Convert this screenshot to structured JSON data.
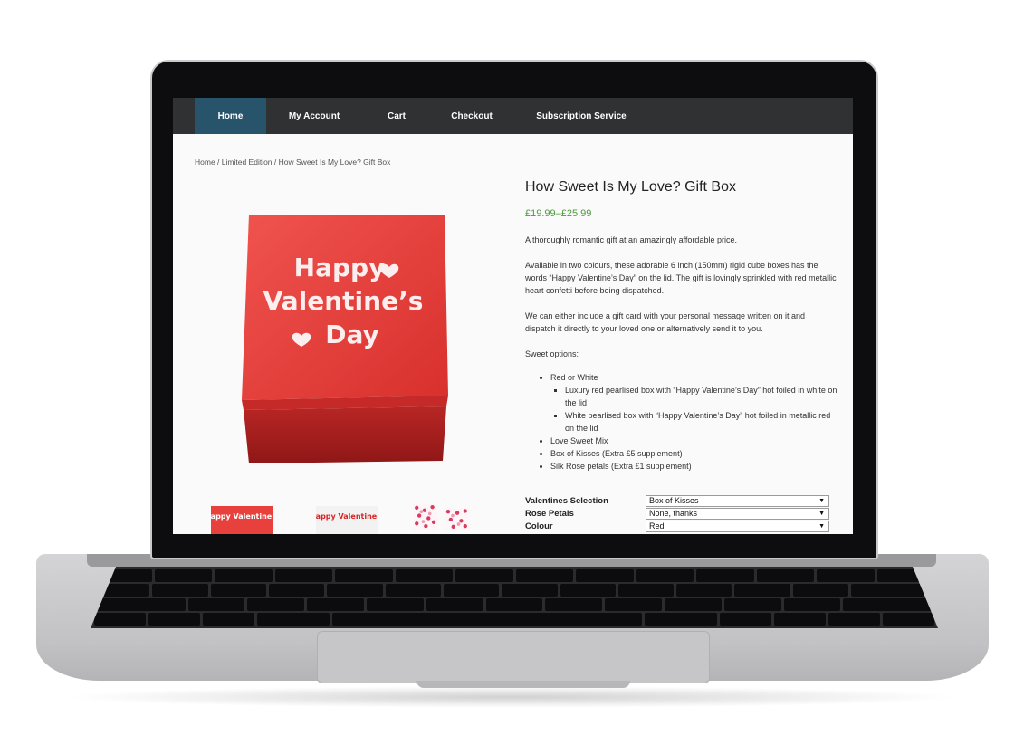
{
  "nav": {
    "items": [
      {
        "label": "Home",
        "active": true
      },
      {
        "label": "My Account"
      },
      {
        "label": "Cart"
      },
      {
        "label": "Checkout"
      },
      {
        "label": "Subscription Service"
      }
    ]
  },
  "breadcrumb": {
    "home": "Home",
    "sep1": " / ",
    "category": "Limited Edition",
    "sep2": " / ",
    "current": "How Sweet Is My Love? Gift Box"
  },
  "product": {
    "title": "How Sweet Is My Love? Gift Box",
    "price": "£19.99–£25.99",
    "box_text": [
      "Happy",
      "Valentine’s",
      "Day"
    ],
    "description": [
      "A thoroughly romantic gift at an amazingly affordable price.",
      "Available in two colours, these adorable 6 inch (150mm) rigid cube boxes has the words “Happy Valentine’s Day” on the lid. The gift is lovingly sprinkled with red metallic heart confetti before being dispatched.",
      "We can either include a gift card with your personal message written on it and dispatch it directly to your loved one or alternatively send it to you.",
      "Sweet options:"
    ],
    "options": {
      "red_or_white": "Red or White",
      "sub": [
        "Luxury red pearlised box with “Happy Valentine’s Day” hot foiled in white on the lid",
        "White pearlised box with “Happy Valentine’s Day” hot foiled in metallic red on the lid"
      ],
      "others": [
        "Love Sweet Mix",
        "Box of Kisses (Extra £5 supplement)",
        "Silk Rose petals (Extra £1 supplement)"
      ]
    }
  },
  "thumbs": {
    "red_text": "Happy Valentine’s",
    "white_text": "Happy Valentine’s"
  },
  "variations": [
    {
      "label": "Valentines Selection",
      "value": "Box of Kisses"
    },
    {
      "label": "Rose Petals",
      "value": "None, thanks"
    },
    {
      "label": "Colour",
      "value": "Red"
    }
  ],
  "colors": {
    "nav_bg": "#2f3133",
    "nav_active": "#27546b",
    "price": "#4b9a3d",
    "box_red": "#e8413d"
  }
}
